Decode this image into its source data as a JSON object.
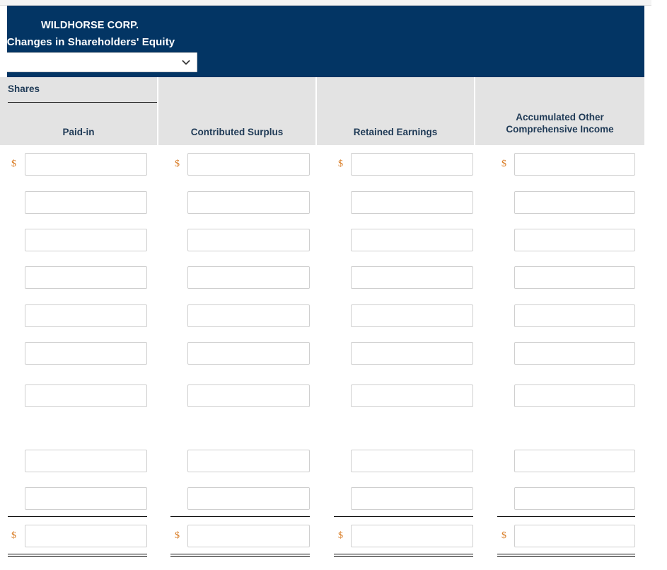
{
  "window": {
    "background_color": "#ffffff",
    "top_strip_color": "#f4f4f4"
  },
  "banner": {
    "background_color": "#033564",
    "company_name": "WILDHORSE CORP.",
    "statement_title": "ent of Changes in Shareholders' Equity",
    "statement_title_full": "Statement of Changes in Shareholders' Equity",
    "period_select": {
      "value": "",
      "placeholder": "",
      "options": [
        ""
      ],
      "chevron_icon": "chevron-down-icon"
    }
  },
  "table": {
    "header_background_color": "#e3e3e3",
    "header_text_color": "#1f3a56",
    "shares_label": "Shares",
    "columns": [
      {
        "label": "Paid-in",
        "lines": [
          "Paid-in"
        ]
      },
      {
        "label": "Contributed Surplus",
        "lines": [
          "Contributed Surplus"
        ]
      },
      {
        "label": "Retained Earnings",
        "lines": [
          "Retained Earnings"
        ]
      },
      {
        "label": "Accumulated Other Comprehensive Income",
        "lines": [
          "Accumulated Other",
          "Comprehensive Income"
        ]
      }
    ],
    "dollar_sign": "$",
    "dollar_sign_color": "#d97b23",
    "input_border_color": "#cfcfcf",
    "rows": [
      {
        "index": 0,
        "show_dollar": true,
        "values": [
          "",
          "",
          "",
          ""
        ]
      },
      {
        "index": 1,
        "show_dollar": false,
        "values": [
          "",
          "",
          "",
          ""
        ]
      },
      {
        "index": 2,
        "show_dollar": false,
        "values": [
          "",
          "",
          "",
          ""
        ]
      },
      {
        "index": 3,
        "show_dollar": false,
        "values": [
          "",
          "",
          "",
          ""
        ]
      },
      {
        "index": 4,
        "show_dollar": false,
        "values": [
          "",
          "",
          "",
          ""
        ]
      },
      {
        "index": 5,
        "show_dollar": false,
        "values": [
          "",
          "",
          "",
          ""
        ]
      },
      {
        "index": 6,
        "show_dollar": false,
        "values": [
          "",
          "",
          "",
          ""
        ]
      },
      {
        "index": 7,
        "show_dollar": false,
        "values": [
          "",
          "",
          "",
          ""
        ]
      },
      {
        "index": 8,
        "show_dollar": false,
        "values": [
          "",
          "",
          "",
          ""
        ]
      },
      {
        "index": 9,
        "show_dollar": true,
        "values": [
          "",
          "",
          "",
          ""
        ],
        "is_total": true
      }
    ]
  }
}
